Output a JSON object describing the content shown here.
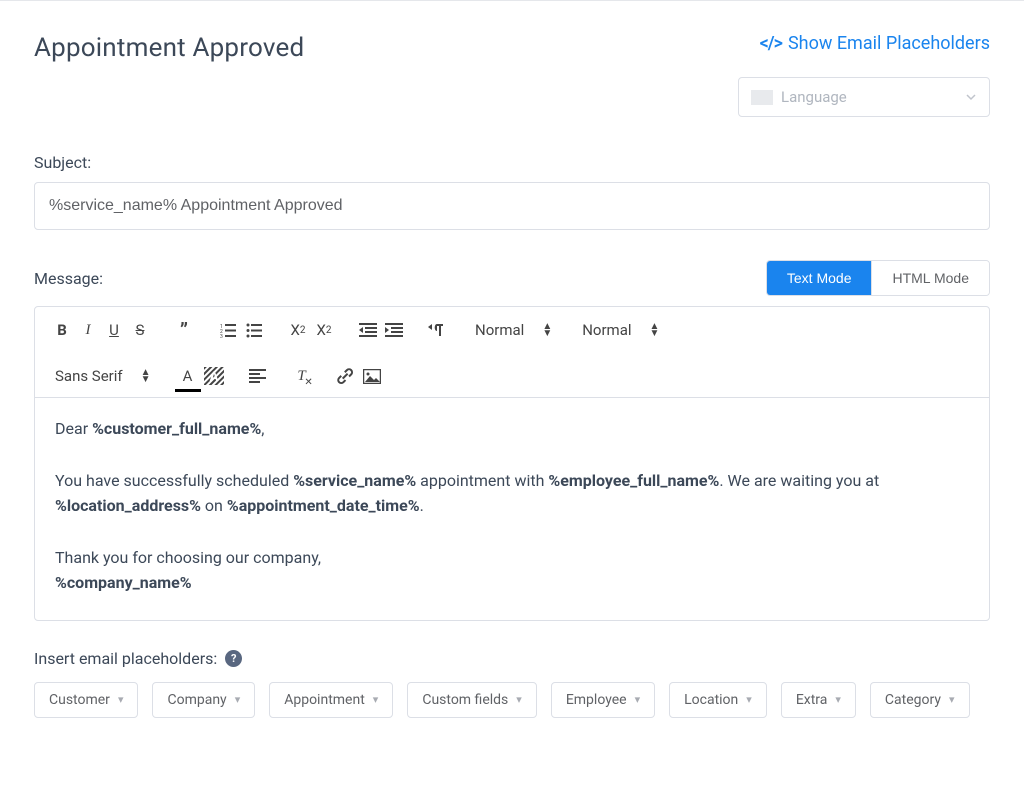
{
  "header": {
    "title": "Appointment Approved",
    "show_placeholders_label": "Show Email Placeholders"
  },
  "language": {
    "placeholder": "Language"
  },
  "subject": {
    "label": "Subject:",
    "value": "%service_name% Appointment Approved"
  },
  "message": {
    "label": "Message:",
    "modes": {
      "text": "Text Mode",
      "html": "HTML Mode"
    }
  },
  "toolbar": {
    "header_select": "Normal",
    "size_select": "Normal",
    "font_select": "Sans Serif"
  },
  "body": {
    "line1_a": "Dear ",
    "line1_b": "%customer_full_name%",
    "line1_c": ",",
    "line2_a": "You have successfully scheduled ",
    "line2_b": "%service_name%",
    "line2_c": " appointment with ",
    "line2_d": "%employee_full_name%",
    "line2_e": ". We are waiting you at ",
    "line2_f": "%location_address%",
    "line2_g": " on ",
    "line2_h": "%appointment_date_time%",
    "line2_i": ".",
    "line3_a": "Thank you for choosing our company,",
    "line3_b": "%company_name%"
  },
  "insert": {
    "label": "Insert email placeholders:",
    "chips": [
      "Customer",
      "Company",
      "Appointment",
      "Custom fields",
      "Employee",
      "Location",
      "Extra",
      "Category"
    ]
  }
}
